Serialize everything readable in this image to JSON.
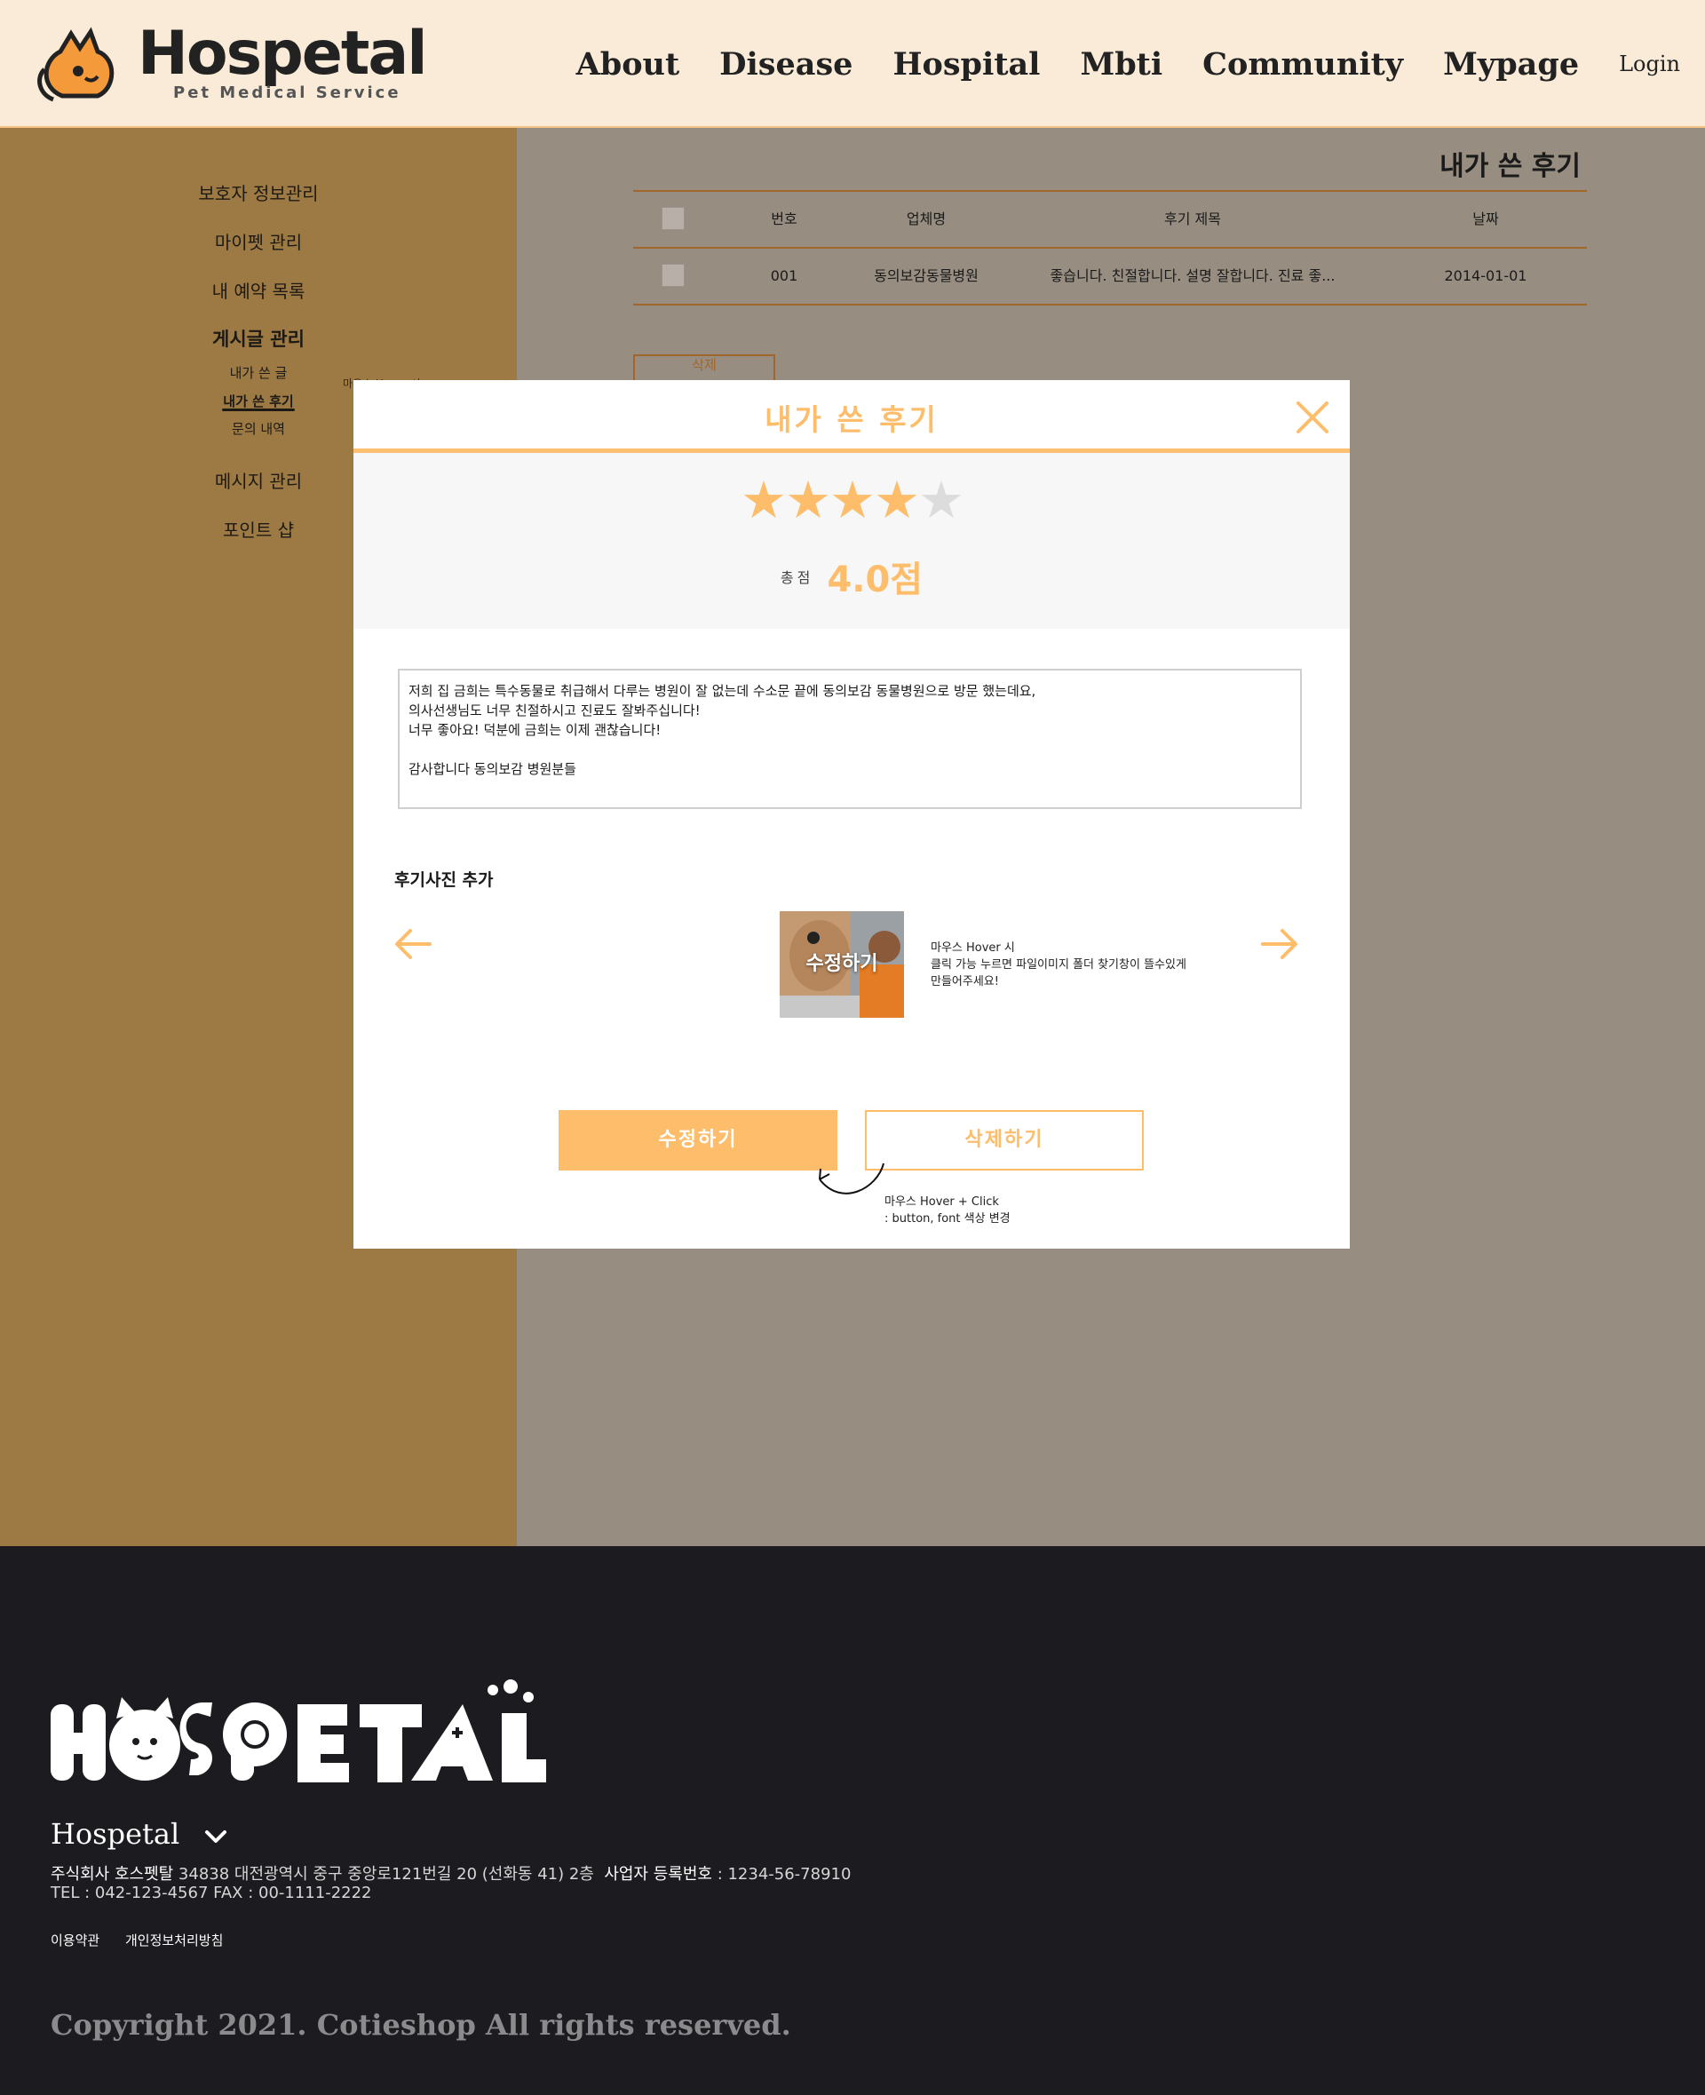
{
  "header": {
    "logo_word": "Hospetal",
    "logo_sub": "Pet Medical Service",
    "nav": [
      "About",
      "Disease",
      "Hospital",
      "Mbti",
      "Community",
      "Mypage"
    ],
    "login": "Login"
  },
  "sidebar": {
    "items": [
      "보호자 정보관리",
      "마이펫 관리",
      "내 예약 목록",
      "게시글 관리",
      "메시지 관리",
      "포인트 샵"
    ],
    "sub_items": [
      "내가 쓴 글",
      "내가 쓴 후기",
      "문의 내역"
    ],
    "note": "마우스 Hover 시"
  },
  "content": {
    "title": "내가 쓴 후기",
    "columns": [
      "번호",
      "업체명",
      "후기 제목",
      "날짜"
    ],
    "rows": [
      {
        "no": "001",
        "company": "동의보감동물병원",
        "title": "좋습니다. 친절합니다. 설명 잘합니다. 진료 좋...",
        "date": "2014-01-01"
      }
    ],
    "delete_label": "삭제"
  },
  "modal": {
    "title": "내가 쓴 후기",
    "rating": 4,
    "rating_max": 5,
    "score_label": "총점",
    "score_value": "4.0점",
    "review_text": "저희 집 금희는 특수동물로 취급해서 다루는 병원이 잘 없는데 수소문 끝에 동의보감 동물병원으로 방문 했는데요,\n의사선생님도 너무 친절하시고 진료도 잘봐주십니다!\n너무 좋아요! 덕분에 금희는 이제 괜찮습니다!\n\n감사합니다 동의보감 병원분들",
    "photo_label": "후기사진 추가",
    "photo_edit": "수정하기",
    "photo_note": [
      "마우스 Hover 시",
      "클릭 가능 누르면 파일이미지 폴더 찾기창이 뜰수있게",
      "만들어주세요!"
    ],
    "edit_button": "수정하기",
    "delete_button": "삭제하기",
    "button_note": [
      "마우스 Hover + Click",
      ": button, font 색상 변경"
    ]
  },
  "footer": {
    "brand": "Hospetal",
    "company_label": "주식회사 호스펫탈",
    "address_tail": " 34838 대전광역시 중구 중앙로121번길 20 (선화동 41) 2층",
    "biz_label": "사업자 등록번호",
    "biz_tail": " : 1234-56-78910",
    "tel": "TEL : 042-123-4567 FAX : 00-1111-2222",
    "links": [
      "이용약관",
      "개인정보처리방침"
    ],
    "copyright": "Copyright 2021. Cotieshop All rights reserved."
  },
  "colors": {
    "accent": "#fdbd6b",
    "header_bg": "#f9ebd8",
    "sidebar_dim": "#9d7a43",
    "content_dim": "#978d81",
    "footer_bg": "#1c1b20"
  }
}
